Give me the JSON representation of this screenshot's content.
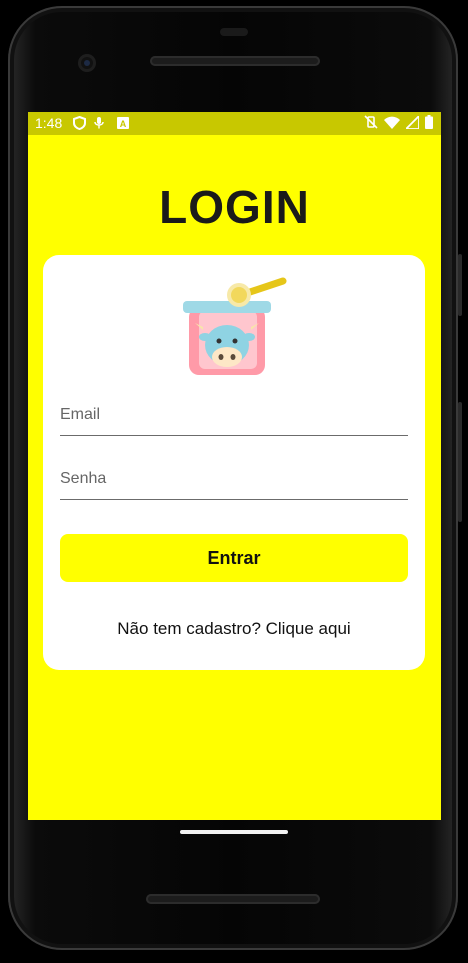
{
  "status_bar": {
    "time": "1:48",
    "left_icons": [
      "shield-icon",
      "mic-icon",
      "font-a-icon"
    ],
    "right_icons": [
      "vibrate-off-icon",
      "wifi-icon",
      "signal-icon",
      "battery-icon"
    ]
  },
  "page": {
    "title": "LOGIN"
  },
  "form": {
    "email_placeholder": "Email",
    "password_placeholder": "Senha",
    "submit_label": "Entrar",
    "signup_text": "Não tem cadastro? Clique aqui"
  },
  "colors": {
    "background": "#ffff00",
    "status_bar": "#c8c800",
    "card": "#ffffff",
    "button": "#ffff00"
  }
}
